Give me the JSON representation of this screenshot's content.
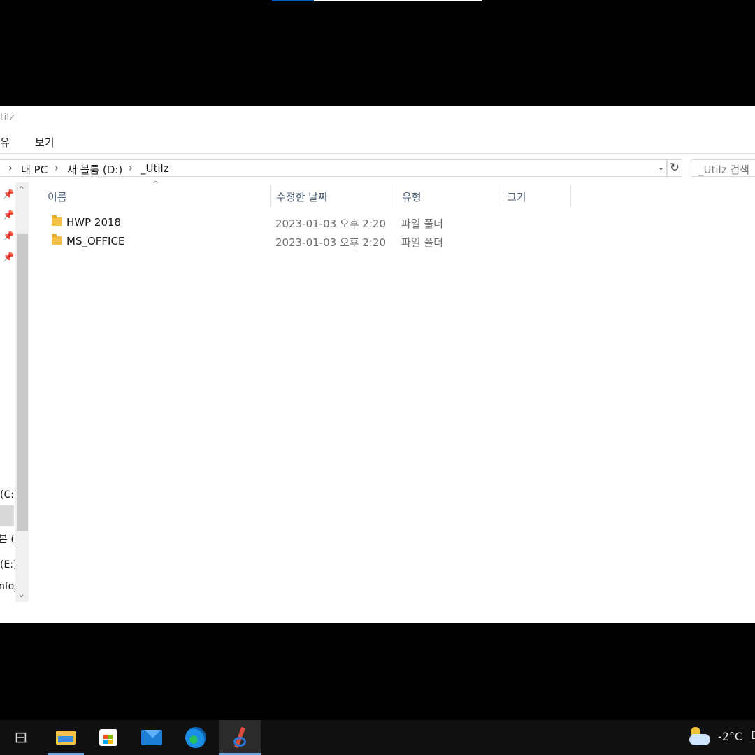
{
  "window": {
    "title_fragment": "tilz"
  },
  "ribbon": {
    "share_fragment": "유",
    "view": "보기"
  },
  "address": {
    "crumbs": [
      "내 PC",
      "새 볼륨 (D:)",
      "_Utilz"
    ],
    "separator": "›",
    "dropdown_icon": "chevron-down-icon",
    "refresh_icon": "refresh-icon",
    "refresh_glyph": "↻",
    "dropdown_glyph": "⌄"
  },
  "search": {
    "placeholder": "_Utilz 검색"
  },
  "nav": {
    "pins": [
      "📌",
      "📌",
      "📌",
      "📌"
    ],
    "drives": [
      "(C:)",
      "본 (E",
      "(E:)",
      "nfo_"
    ],
    "scroll_up": "⌃",
    "scroll_down": "⌄"
  },
  "columns": [
    "이름",
    "수정한 날짜",
    "유형",
    "크기"
  ],
  "sort_indicator": "^",
  "files": [
    {
      "name": "HWP 2018",
      "date": "2023-01-03 오후 2:20",
      "type": "파일 폴더",
      "size": ""
    },
    {
      "name": "MS_OFFICE",
      "date": "2023-01-03 오후 2:20",
      "type": "파일 폴더",
      "size": ""
    }
  ],
  "taskbar": {
    "apps": [
      "task-view-icon",
      "file-explorer-icon",
      "store-icon",
      "mail-icon",
      "edge-icon",
      "snip-sketch-icon"
    ],
    "task_view_glyph": "⊟",
    "weather_icon": "partly-cloudy-night-icon",
    "temperature": "-2°C",
    "tray_fragment": "D"
  },
  "colors": {
    "accent": "#0a5bc4",
    "folder": "#f3c04a",
    "taskbar": "#101010",
    "active_underline": "#6ea7e6"
  }
}
